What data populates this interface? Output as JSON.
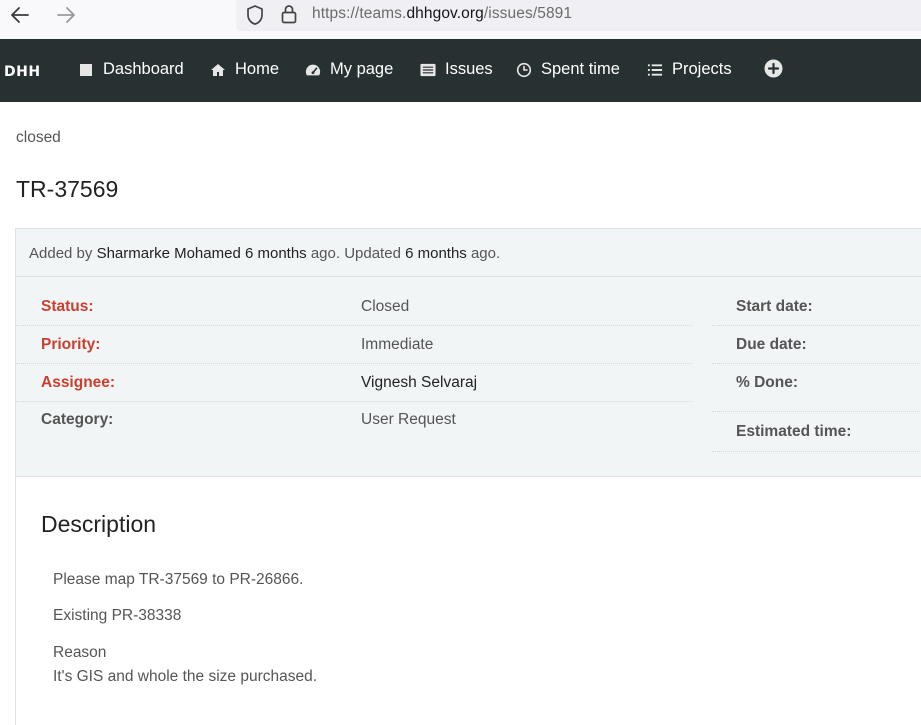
{
  "browser": {
    "url_prefix": "https://teams.",
    "url_domain": "dhhgov.org",
    "url_path": "/issues/5891"
  },
  "topnav": {
    "brand": "DHH",
    "items": [
      {
        "label": "Dashboard",
        "icon": "square-icon"
      },
      {
        "label": "Home",
        "icon": "home-icon"
      },
      {
        "label": "My page",
        "icon": "gauge-icon"
      },
      {
        "label": "Issues",
        "icon": "list-icon"
      },
      {
        "label": "Spent time",
        "icon": "clock-icon"
      },
      {
        "label": "Projects",
        "icon": "projects-icon"
      }
    ],
    "plus_icon": "plus-circle-icon"
  },
  "issue": {
    "status_text": "closed",
    "title": "TR-37569",
    "added_by_prefix": "Added by ",
    "author": "Sharmarke Mohamed",
    "created_ago": "6 months",
    "ago_updated": " ago. Updated ",
    "updated_ago": "6 months",
    "ago_end": " ago.",
    "attributes_left": [
      {
        "label": "Status:",
        "value": "Closed"
      },
      {
        "label": "Priority:",
        "value": "Immediate"
      },
      {
        "label": "Assignee:",
        "value": "Vignesh Selvaraj"
      },
      {
        "label": "Category:",
        "value": "User Request"
      }
    ],
    "attributes_right": [
      {
        "label": "Start date:",
        "value": ""
      },
      {
        "label": "Due date:",
        "value": ""
      },
      {
        "label": "% Done:",
        "value": ""
      },
      {
        "label": "Estimated time:",
        "value": ""
      }
    ],
    "description_title": "Description",
    "description_lines": [
      "Please map TR-37569 to PR-26866.",
      "Existing PR-38338",
      "Reason",
      "It's GIS and whole the size purchased."
    ]
  },
  "colors": {
    "nav_bg": "#273132",
    "required_label": "#c9402f",
    "box_bg": "#f1f5f6"
  }
}
